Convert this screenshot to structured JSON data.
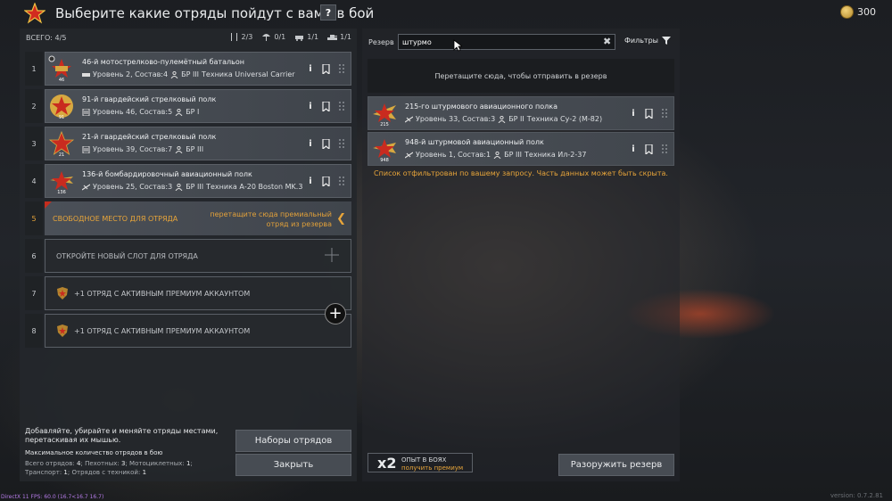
{
  "header": {
    "title": "Выберите какие отряды пойдут с вами в бой",
    "help_label": "?",
    "gold_amount": "300"
  },
  "left": {
    "total_label": "ВСЕГО: 4/5",
    "stats": [
      "2/3",
      "0/1",
      "1/1",
      "1/1"
    ],
    "slots": [
      {
        "num": "1",
        "name": "46-й мотострелково-пулемётный батальон",
        "info": "Уровень 2, Состав:4",
        "br": "БР III",
        "tech": "Техника Universal Carrier",
        "emblem_num": "46"
      },
      {
        "num": "2",
        "name": "91-й гвардейский стрелковый полк",
        "info": "Уровень 46, Состав:5",
        "br": "БР I",
        "tech": "",
        "emblem_num": "91"
      },
      {
        "num": "3",
        "name": "21-й гвардейский стрелковый полк",
        "info": "Уровень 39, Состав:7",
        "br": "БР III",
        "tech": "",
        "emblem_num": "21"
      },
      {
        "num": "4",
        "name": "136-й бомбардировочный авиационный полк",
        "info": "Уровень 25, Состав:3",
        "br": "БР III",
        "tech": "Техника А-20 Boston MK.3",
        "emblem_num": "136"
      }
    ],
    "free_slot": {
      "num": "5",
      "label": "СВОБОДНОЕ МЕСТО ДЛЯ ОТРЯДА",
      "hint": "перетащите сюда премиальный отряд из резерва"
    },
    "open_slot": {
      "num": "6",
      "label": "ОТКРОЙТЕ НОВЫЙ СЛОТ ДЛЯ ОТРЯДА"
    },
    "premium_slots": [
      {
        "num": "7",
        "label": "+1 ОТРЯД С АКТИВНЫМ ПРЕМИУМ АККАУНТОМ"
      },
      {
        "num": "8",
        "label": "+1 ОТРЯД С АКТИВНЫМ ПРЕМИУМ АККАУНТОМ"
      }
    ],
    "tip": "Добавляйте, убирайте и меняйте отряды местами, перетаскивая их мышью.",
    "limits_title": "Максимальное количество отрядов в бою",
    "limits": {
      "total_label": "Всего отрядов:",
      "total": "4",
      "infantry_label": "Пехотных:",
      "infantry": "3",
      "moto_label": "Мотоциклетных:",
      "moto": "1",
      "transport_label": "Транспорт:",
      "transport": "1",
      "tech_label": "Отрядов с техникой:",
      "tech": "1"
    },
    "presets_button": "Наборы отрядов",
    "close_button": "Закрыть"
  },
  "right": {
    "reserve_label": "Резерв",
    "search_value": "штурмо",
    "filters_label": "Фильтры",
    "drop_zone": "Перетащите сюда, чтобы отправить в резерв",
    "reserve_units": [
      {
        "name": "215-го штурмового авиационного полка",
        "info": "Уровень 33, Состав:3",
        "br": "БР II",
        "tech": "Техника Су-2 (М-82)",
        "emblem_num": "215"
      },
      {
        "name": "948-й штурмовой авиационный полк",
        "info": "Уровень 1, Состав:1",
        "br": "БР III",
        "tech": "Техника Ил-2-37",
        "emblem_num": "948"
      }
    ],
    "filter_note": "Список отфильтрован по вашему запросу. Часть данных может быть скрыта.",
    "exp_mult": "x2",
    "exp_line1": "ОПЫТ В БОЯХ",
    "exp_line2": "получить премиум",
    "disarm_button": "Разоружить резерв"
  },
  "footer": {
    "fps": "DirectX 11 FPS: 60.0 (16.7<16.7 16.7)",
    "version": "version: 0.7.2.81"
  },
  "colors": {
    "accent": "#e8a53a",
    "red": "#c52d1e",
    "gold": "#d9b04a"
  }
}
